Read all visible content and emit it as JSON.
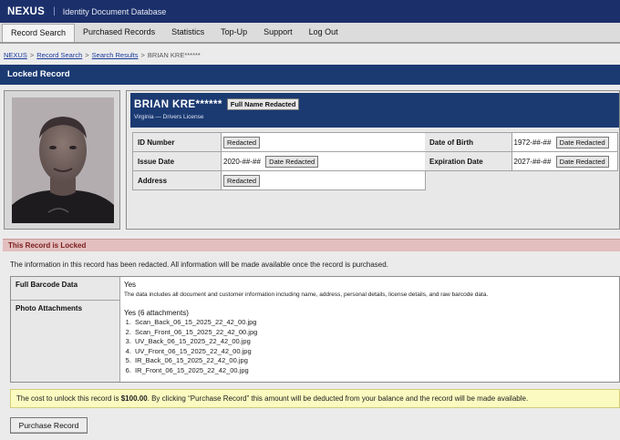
{
  "app": {
    "brand": "NEXUS",
    "separator": "|",
    "subtitle": "Identity Document Database"
  },
  "nav": {
    "items": [
      {
        "label": "Record Search",
        "active": true
      },
      {
        "label": "Purchased Records",
        "active": false
      },
      {
        "label": "Statistics",
        "active": false
      },
      {
        "label": "Top-Up",
        "active": false
      },
      {
        "label": "Support",
        "active": false
      },
      {
        "label": "Log Out",
        "active": false
      }
    ]
  },
  "breadcrumb": {
    "items": [
      "NEXUS",
      "Record Search",
      "Search Results"
    ],
    "current": "BRIAN KRE******",
    "separator": ">"
  },
  "header": {
    "title": "Locked Record"
  },
  "record": {
    "name": "BRIAN KRE******",
    "name_badge": "Full Name Redacted",
    "subtitle": "Virginia — Drivers License",
    "fields_left": [
      {
        "label": "ID Number",
        "value": "",
        "badge": "Redacted"
      },
      {
        "label": "Issue Date",
        "value": "2020-##-##",
        "badge": "Date Redacted"
      },
      {
        "label": "Address",
        "value": "",
        "badge": "Redacted"
      }
    ],
    "fields_right": [
      {
        "label": "Date of Birth",
        "value": "1972-##-##",
        "badge": "Date Redacted"
      },
      {
        "label": "Expiration Date",
        "value": "2027-##-##",
        "badge": "Date Redacted"
      }
    ]
  },
  "lock": {
    "banner": "This Record is Locked",
    "message": "The information in this record has been redacted. All information will be made available once the record is purchased."
  },
  "barcode": {
    "label": "Full Barcode Data",
    "value": "Yes",
    "description": "The data includes all document and customer information including name, address, personal details, license details, and raw barcode data."
  },
  "photos": {
    "label": "Photo Attachments",
    "value": "Yes (6 attachments)",
    "files": [
      "Scan_Back_06_15_2025_22_42_00.jpg",
      "Scan_Front_06_15_2025_22_42_00.jpg",
      "UV_Back_06_15_2025_22_42_00.jpg",
      "UV_Front_06_15_2025_22_42_00.jpg",
      "IR_Back_06_15_2025_22_42_00.jpg",
      "IR_Front_06_15_2025_22_42_00.jpg"
    ]
  },
  "cost": {
    "prefix": "The cost to unlock this record is ",
    "amount": "$100.00",
    "suffix": ". By clicking “Purchase Record” this amount will be deducted from your balance and the record will be made available."
  },
  "actions": {
    "purchase_label": "Purchase Record"
  },
  "colors": {
    "top_bar": "#1b2f6a",
    "header_blue": "#1b3a72",
    "lock_banner_bg": "#e3bfbf",
    "lock_banner_text": "#7a1c1c",
    "cost_bg": "#fbfac0",
    "link": "#1a3a9e"
  }
}
